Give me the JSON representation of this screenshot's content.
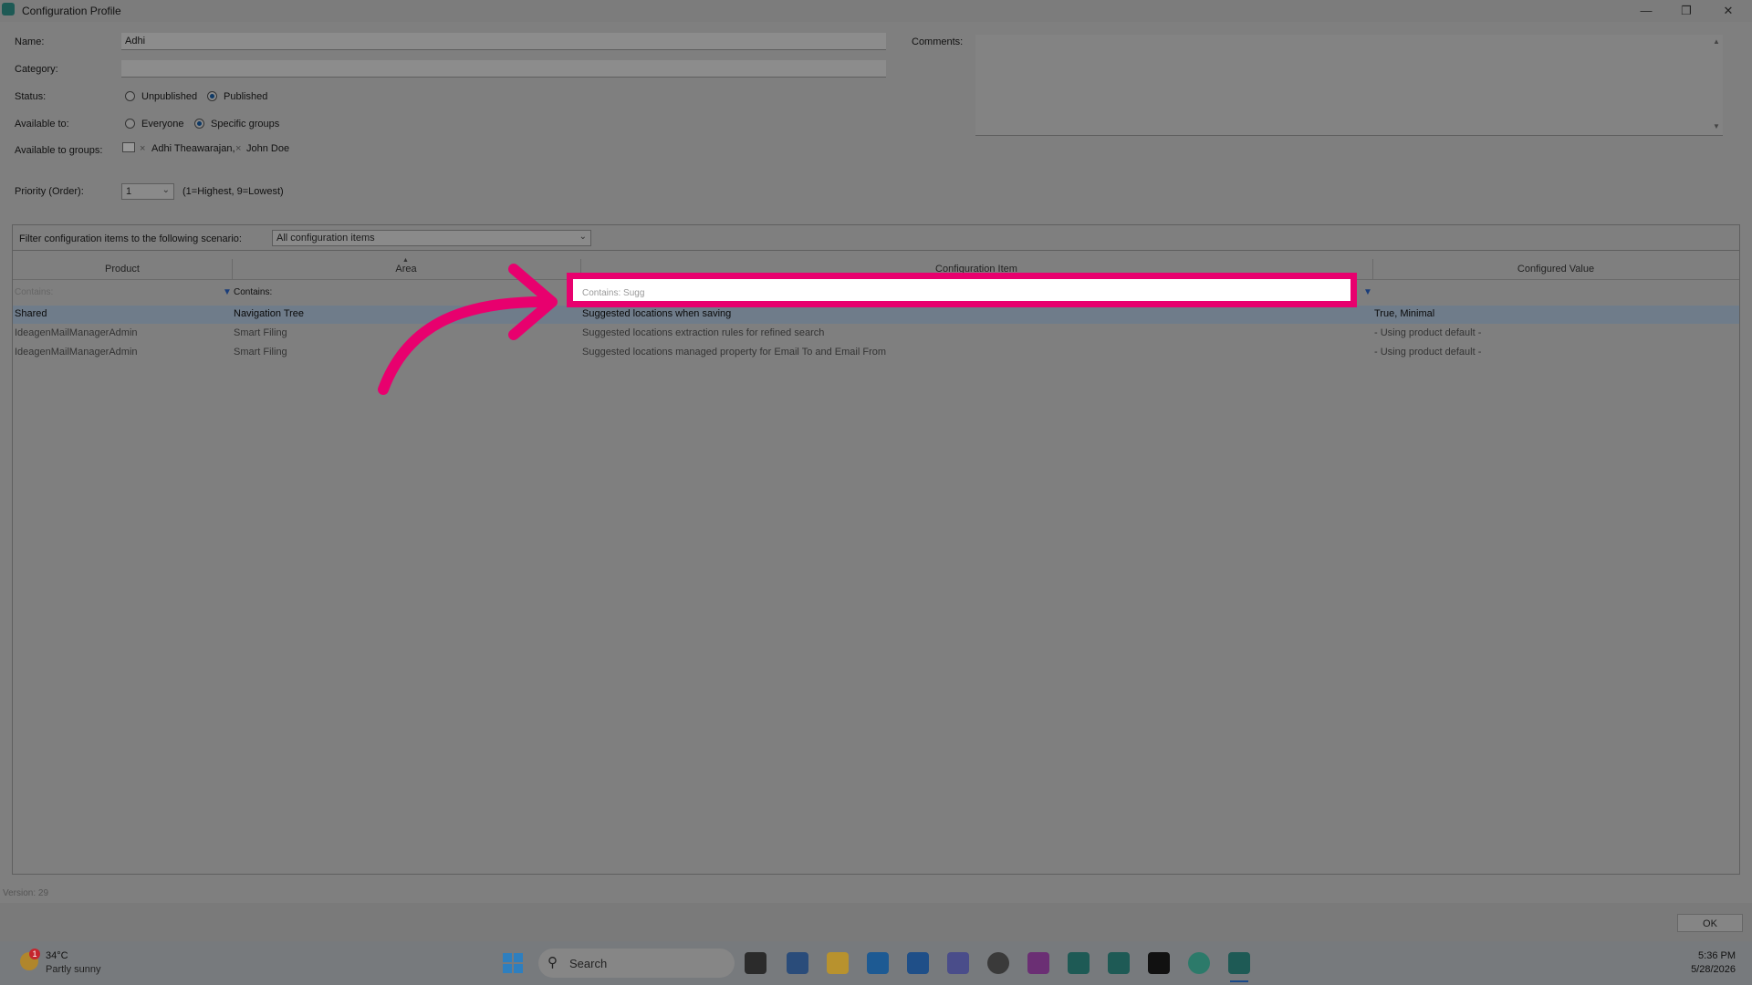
{
  "window": {
    "title": "Configuration Profile",
    "minimize_icon": "minimize-icon",
    "restore_icon": "restore-icon",
    "close_icon": "close-icon"
  },
  "form": {
    "name_label": "Name:",
    "name_value": "Adhi",
    "category_label": "Category:",
    "category_value": "",
    "comments_label": "Comments:",
    "status_label": "Status:",
    "status_options": [
      "Unpublished",
      "Published"
    ],
    "status_selected": "Published",
    "available_label": "Available to:",
    "available_options": [
      "Everyone",
      "Specific groups"
    ],
    "available_selected": "Specific groups",
    "groups_label": "Available to groups:",
    "groups": [
      "Adhi Theawarajan,",
      "John  Doe"
    ],
    "priority_label": "Priority (Order):",
    "priority_value": "1",
    "priority_hint": "(1=Highest, 9=Lowest)"
  },
  "scenario": {
    "label": "Filter configuration items to the following scenario:",
    "value": "All configuration items"
  },
  "grid": {
    "columns": [
      "Product",
      "Area",
      "Configuration Item",
      "Configured Value"
    ],
    "filters": {
      "product": "Contains:",
      "area": "Contains:",
      "item": "Contains: Sugg"
    },
    "rows": [
      {
        "product": "Shared",
        "area": "Navigation Tree",
        "item": "Suggested locations when saving",
        "value": "True, Minimal",
        "selected": true
      },
      {
        "product": "IdeagenMailManagerAdmin",
        "area": "Smart Filing",
        "item": "Suggested locations extraction rules for refined search",
        "value": "- Using product default -",
        "selected": false
      },
      {
        "product": "IdeagenMailManagerAdmin",
        "area": "Smart Filing",
        "item": "Suggested locations managed property for Email To and Email From",
        "value": "- Using product default -",
        "selected": false
      }
    ]
  },
  "footer": {
    "version": "Version:  29",
    "ok_label": "OK"
  },
  "taskbar": {
    "weather_temp": "34°C",
    "weather_desc": "Partly sunny",
    "weather_badge": "1",
    "search_placeholder": "Search",
    "time": "5:36 PM",
    "date": "5/28/2026"
  },
  "colors": {
    "highlight": "#e8006e",
    "accent": "#0f3a66"
  }
}
